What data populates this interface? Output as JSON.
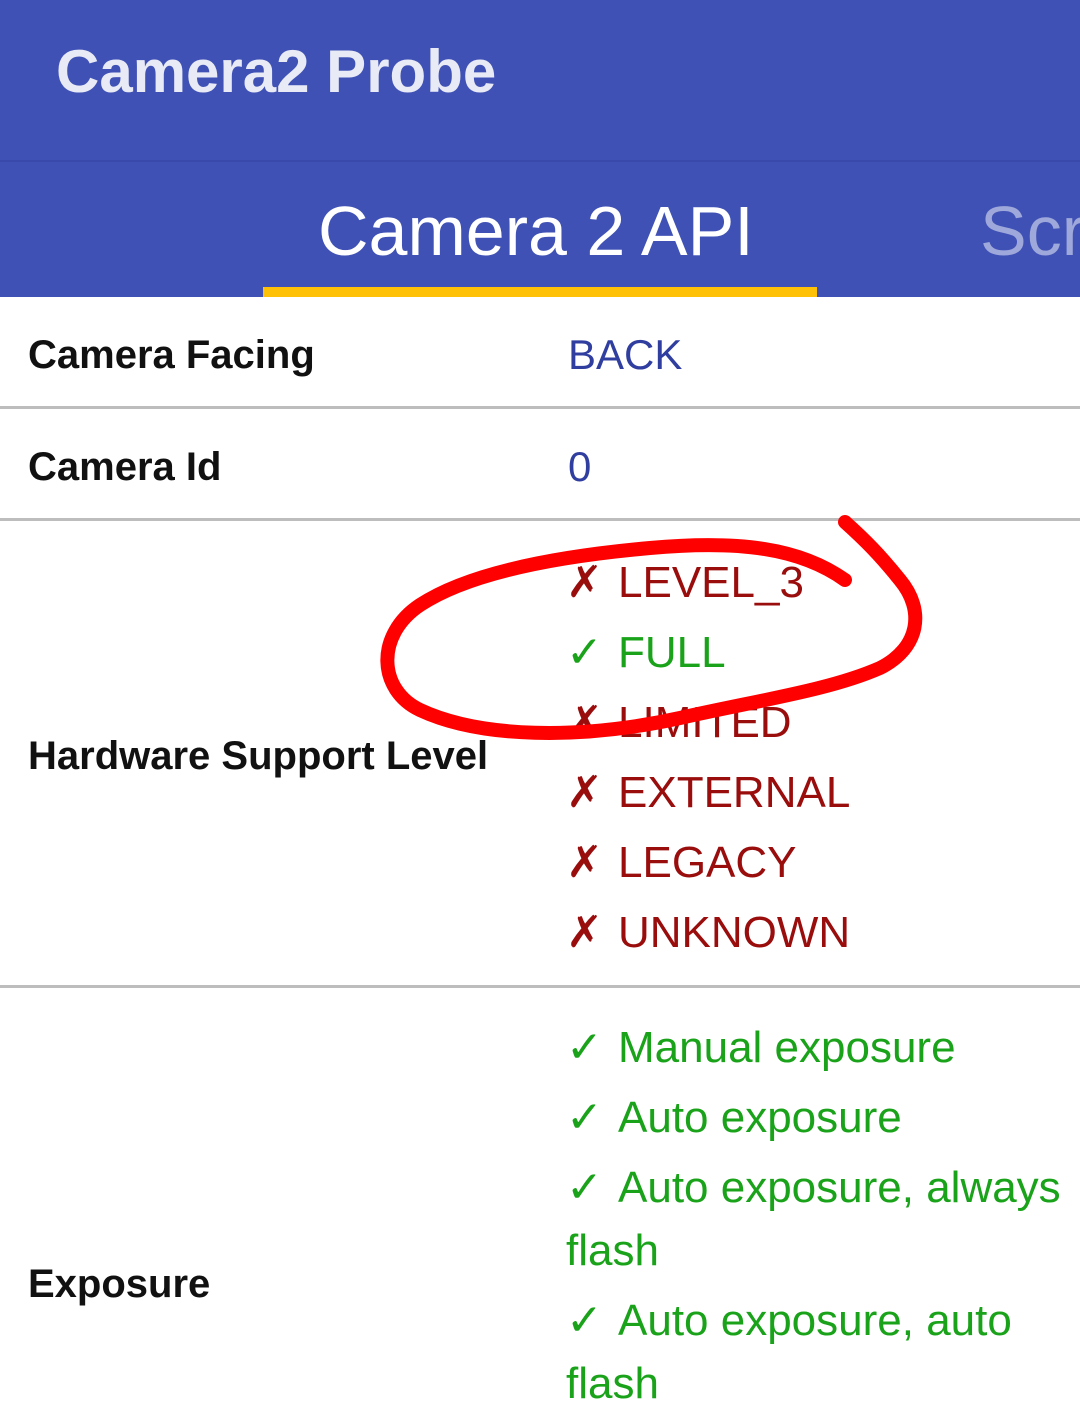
{
  "app": {
    "title": "Camera2 Probe"
  },
  "tabs": [
    {
      "label": "Camera 2 API"
    },
    {
      "label": "Scr"
    }
  ],
  "rows": {
    "camera_facing": {
      "label": "Camera Facing",
      "value": "BACK"
    },
    "camera_id": {
      "label": "Camera Id",
      "value": "0"
    },
    "hardware_level": {
      "label": "Hardware Support Level",
      "items": [
        {
          "mark": "✗",
          "text": "LEVEL_3"
        },
        {
          "mark": "✓",
          "text": "FULL"
        },
        {
          "mark": "✗",
          "text": "LIMITED"
        },
        {
          "mark": "✗",
          "text": "EXTERNAL"
        },
        {
          "mark": "✗",
          "text": "LEGACY"
        },
        {
          "mark": "✗",
          "text": "UNKNOWN"
        }
      ]
    },
    "exposure": {
      "label": "Exposure",
      "items": [
        {
          "mark": "✓",
          "text": "Manual exposure"
        },
        {
          "mark": "✓",
          "text": "Auto exposure"
        },
        {
          "mark": "✓",
          "text": "Auto exposure, always flash"
        },
        {
          "mark": "✓",
          "text": "Auto exposure, auto flash"
        }
      ]
    }
  },
  "colors": {
    "primary": "#3f51b5",
    "accent": "#ffc107",
    "supported": "#1aa31a",
    "unsupported": "#9a0d0d",
    "value_blue": "#303f9f",
    "annotation_red": "#ff0000"
  },
  "annotation": {
    "type": "hand-drawn-circle",
    "target": "FULL"
  }
}
